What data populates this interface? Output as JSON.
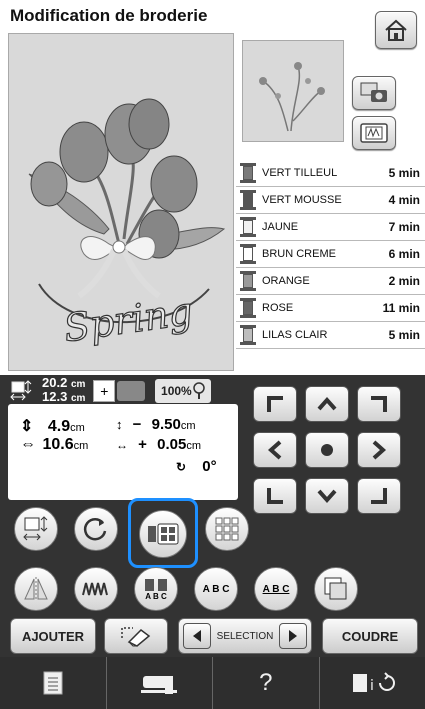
{
  "title": "Modification de broderie",
  "colors": [
    {
      "name": "VERT TILLEUL",
      "time": "5",
      "unit": "min",
      "shade": "#7a7a7a"
    },
    {
      "name": "VERT MOUSSE",
      "time": "4",
      "unit": "min",
      "shade": "#555555"
    },
    {
      "name": "JAUNE",
      "time": "7",
      "unit": "min",
      "shade": "#f1f1f1"
    },
    {
      "name": "BRUN CREME",
      "time": "6",
      "unit": "min",
      "shade": "#ffffff"
    },
    {
      "name": "ORANGE",
      "time": "2",
      "unit": "min",
      "shade": "#9a9a9a"
    },
    {
      "name": "ROSE",
      "time": "11",
      "unit": "min",
      "shade": "#666666"
    },
    {
      "name": "LILAS CLAIR",
      "time": "5",
      "unit": "min",
      "shade": "#bdbdbd"
    }
  ],
  "size": {
    "width": "20.2",
    "height": "12.3",
    "unit": "cm"
  },
  "zoom": "100%",
  "dims": {
    "h_value": "4.9",
    "w_value": "10.6",
    "unit": "cm"
  },
  "offsets": {
    "y_sign": "−",
    "y_value": "9.50",
    "x_sign": "+",
    "x_value": "0.05",
    "unit": "cm"
  },
  "rotation": {
    "value": "0",
    "unit": "°"
  },
  "preview_text": "Spring",
  "buttons": {
    "ajouter": "AJOUTER",
    "selection": "SELECTION",
    "coudre": "COUDRE",
    "help": "?",
    "abc1": "A B C",
    "abc2": "A B C",
    "abc3": "A B C"
  },
  "highlight_color": "#1e90ff"
}
